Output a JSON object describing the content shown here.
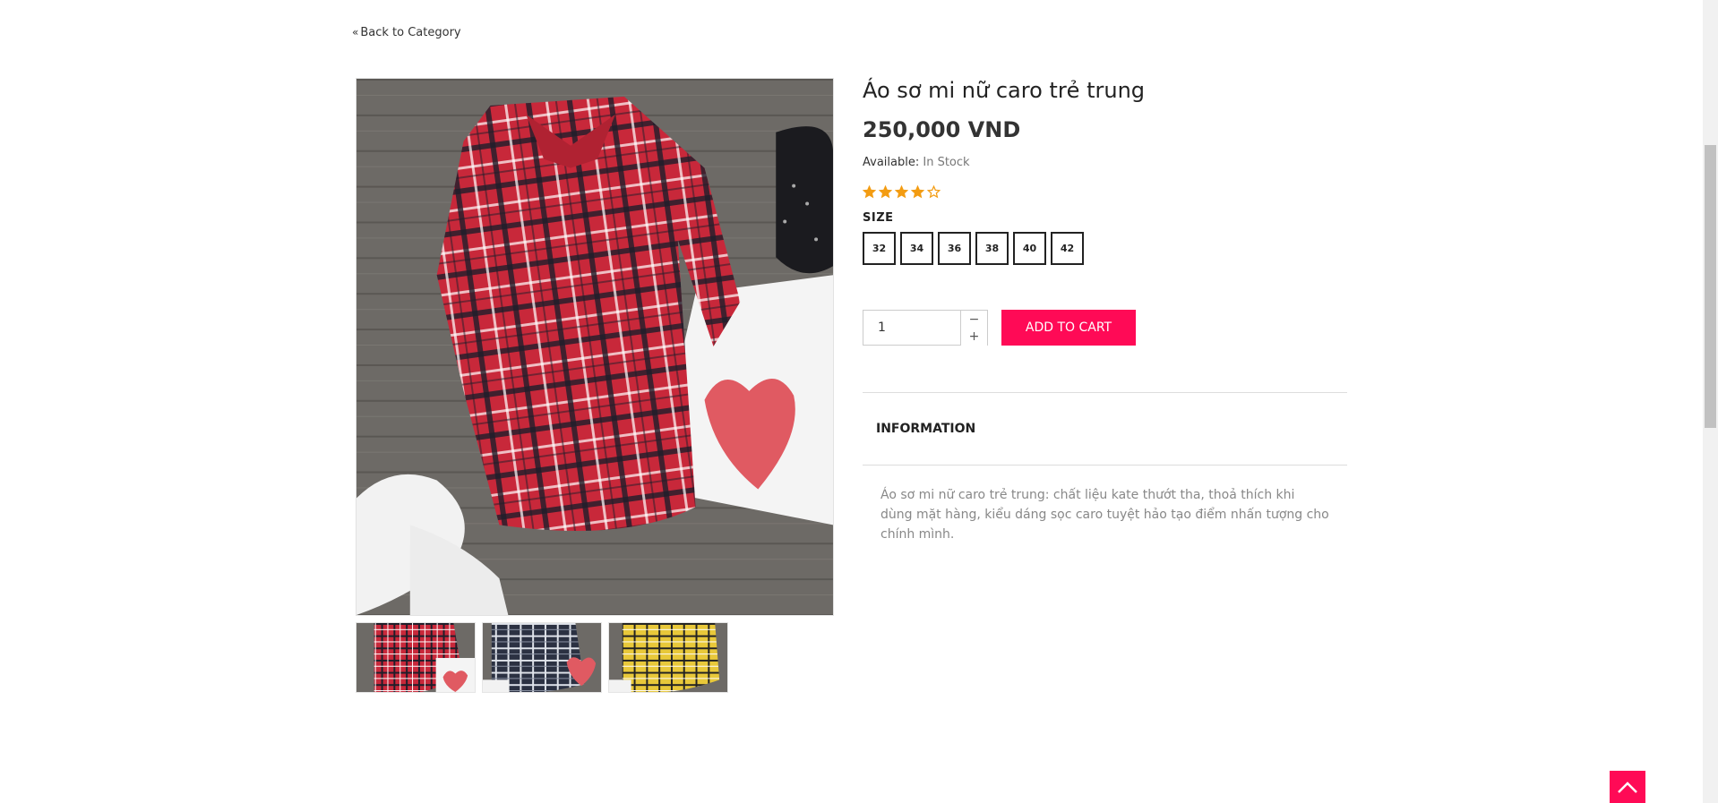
{
  "nav": {
    "back_chevron": "«",
    "back_label": "Back to Category"
  },
  "product": {
    "title": "Áo sơ mi nữ caro trẻ trung",
    "price": "250,000 VND",
    "availability_label": "Available:",
    "availability_value": "In Stock",
    "rating": 4,
    "rating_max": 5,
    "size_label": "SIZE",
    "sizes": [
      "32",
      "34",
      "36",
      "38",
      "40",
      "42"
    ],
    "quantity": "1",
    "qty_minus": "−",
    "qty_plus": "+",
    "add_to_cart": "ADD TO CART",
    "info_tab": "INFORMATION",
    "description": "Áo sơ mi nữ caro trẻ trung: chất liệu kate thướt tha, thoả thích khi dùng mặt hàng, kiểu dáng sọc caro tuyệt hảo tạo điểm nhấn tượng cho chính mình."
  },
  "colors": {
    "accent": "#ff0a56",
    "star": "#f39c12",
    "shirt_red": "#c8283a",
    "shirt_navy": "#2b3142",
    "shirt_yellow": "#e8c83a"
  },
  "icons": {
    "back": "double-chevron-left-icon",
    "star": "star-icon",
    "to_top": "chevron-up-icon"
  }
}
